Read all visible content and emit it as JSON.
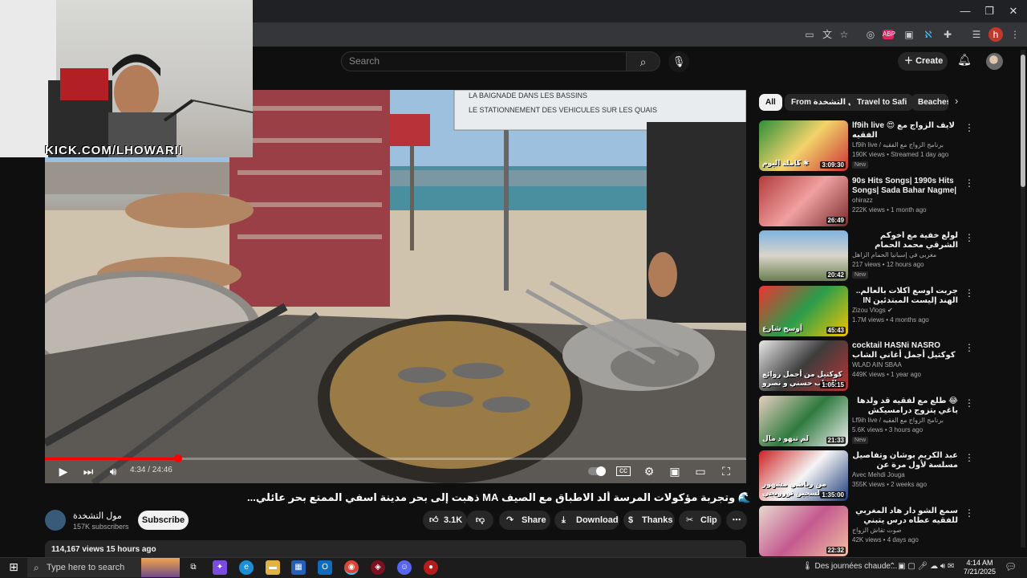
{
  "browser": {
    "window_controls": [
      "—",
      "❐",
      "✕"
    ],
    "toolbar_icons": [
      "cast-icon",
      "translate-icon",
      "bookmark-star-icon",
      "extension-icon-1",
      "extension-icon-2",
      "extension-icon-3",
      "extension-icon-4",
      "puzzle-icon",
      "tab-search-icon",
      "profile-icon",
      "kebab-icon"
    ],
    "profile_initial": "h"
  },
  "youtube": {
    "search_placeholder": "Search",
    "create_label": "Create"
  },
  "webcam": {
    "overlay_text": "KICK.COM/LHOWARII"
  },
  "player": {
    "time": "4:34 / 24:46",
    "progress": 0.19,
    "sign_lines": [
      "LA BAIGNADE DANS LES BASSINS",
      "LE STATIONNEMENT DES VEHICULES SUR LES QUAIS"
    ]
  },
  "video": {
    "title": "🌊 وتجربة مؤكولات المرسة ألد الاطباق مع الصيف MA ذهبت إلى بحر مدينة اسفي الممتع بحر عائلي...",
    "channel": "مول التشخدة",
    "subscribers": "157K subscribers",
    "subscribe_label": "Subscribe",
    "likes": "3.1K",
    "share_label": "Share",
    "download_label": "Download",
    "thanks_label": "Thanks",
    "clip_label": "Clip",
    "views_line": "114,167 views  15 hours ago"
  },
  "chips": {
    "all": "All",
    "from": "From مول التشخدة",
    "travel": "Travel to Safi",
    "beaches": "Beaches"
  },
  "related": [
    {
      "title": "lf9ih live 😍 لايف الزواج مع الفقيه",
      "channel": "Lf9ih live / برنامج الزواج مع الفقيه",
      "meta": "190K views • Streamed 1 day ago",
      "duration": "3:09:30",
      "new": "New",
      "thumb_text": "كاملة اليوم ✱"
    },
    {
      "title": "90s Hits Songs| 1990s Hits Songs| Sada Bahar Nagme| Sr...",
      "channel": "ohirazz",
      "meta": "222K views • 1 month ago",
      "duration": "26:49",
      "new": "",
      "thumb_text": ""
    },
    {
      "title": "لولع خفية مع أخوكم الشرقي محمد الحمام كوانتي ديال الله عز وجل في إسبانيا 🙌",
      "channel": "مغربي في إسبانيا الحمام الزاهل",
      "meta": "217 views • 12 hours ago",
      "duration": "20:42",
      "new": "New",
      "thumb_text": ""
    },
    {
      "title": "جربت أوسع أكلات بالعالم.. الهند إليست المبتدئين IN",
      "channel": "Zizou Vlogs ✔",
      "meta": "1.7M views • 4 months ago",
      "duration": "45:43",
      "new": "",
      "thumb_text": "أوسخ شارع"
    },
    {
      "title": "cocktail HASNi NASRO كوكتيل أجمل أغاني الشاب حسني و نصرو",
      "channel": "WLAD AIN SBAA",
      "meta": "449K views • 1 year ago",
      "duration": "1:05:15",
      "new": "",
      "thumb_text": "كوكتيل من أجمل روائع الشاب حسني و نصرو"
    },
    {
      "title": "😂 طلع مع لفقيه قد ولدها باغي يتزوج درامسيكش فرحو دا لخر",
      "channel": "Lf9ih live / برنامج الزواج مع الفقيه",
      "meta": "5.6K views • 3 hours ago",
      "duration": "21:33",
      "new": "New",
      "thumb_text": "لم تنهو د مال"
    },
    {
      "title": "عبد الكريم بوشان وتفاصيل مسلسة لأول مرة عن علاقته بثروة الذهبي وكيف أنقل من",
      "channel": "Avec Mehdi Jouga",
      "meta": "355K views • 2 weeks ago",
      "duration": "1:35:00",
      "new": "",
      "thumb_text": "من رياضي مشهور لسجين تورويجي"
    },
    {
      "title": "سمع الشو دار هاد المغربي للفقيه عطاه درس يتبني حتى بكاه ولدمو هاد الطفلة راه وثلث",
      "channel": "صوت تقاش الزواج",
      "meta": "42K views • 4 days ago",
      "duration": "22:32",
      "new": "",
      "thumb_text": ""
    }
  ],
  "taskbar": {
    "search_placeholder": "Type here to search",
    "weather": "Des journées chaude...",
    "time": "4:14 AM",
    "date": "7/21/2025"
  },
  "colors": {
    "accent_red": "#ff0000",
    "background": "#0f0f0f",
    "chip": "#272727"
  }
}
